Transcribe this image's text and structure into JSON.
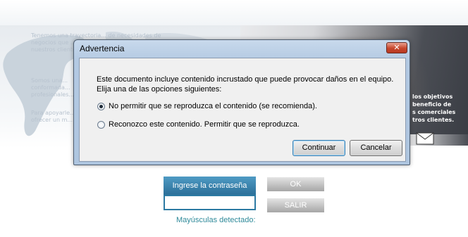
{
  "background": {
    "left_text_lines": [
      "Tenemos una trayectoria... de necesidades de",
      "negocios que ...",
      "nuestros clientes...",
      "",
      "Somos una...",
      "conformada...",
      "profesionales...",
      "",
      "Para apoyarle...",
      "ofrecer un m..."
    ],
    "photo_text_lines": [
      "los objetivos",
      "beneficio de",
      "s comerciales",
      "tros clientes."
    ]
  },
  "login": {
    "password_label": "Ingrese la contraseña",
    "password_value": "",
    "ok_label": "OK",
    "exit_label": "SALIR",
    "caps_message": "Mayúsculas detectado:"
  },
  "dialog": {
    "title": "Advertencia",
    "close_glyph": "✕",
    "message_line1": "Este documento incluye contenido incrustado que puede provocar daños en el equipo.",
    "message_line2": "Elija una de las opciones siguientes:",
    "option1": "No permitir que se reproduzca el contenido (se recomienda).",
    "option2": "Reconozco este contenido. Permitir que se reproduzca.",
    "selected_option": 1,
    "continue_label": "Continuar",
    "cancel_label": "Cancelar"
  },
  "icons": {
    "dialog_close": "close-icon",
    "mail": "mail-icon"
  }
}
